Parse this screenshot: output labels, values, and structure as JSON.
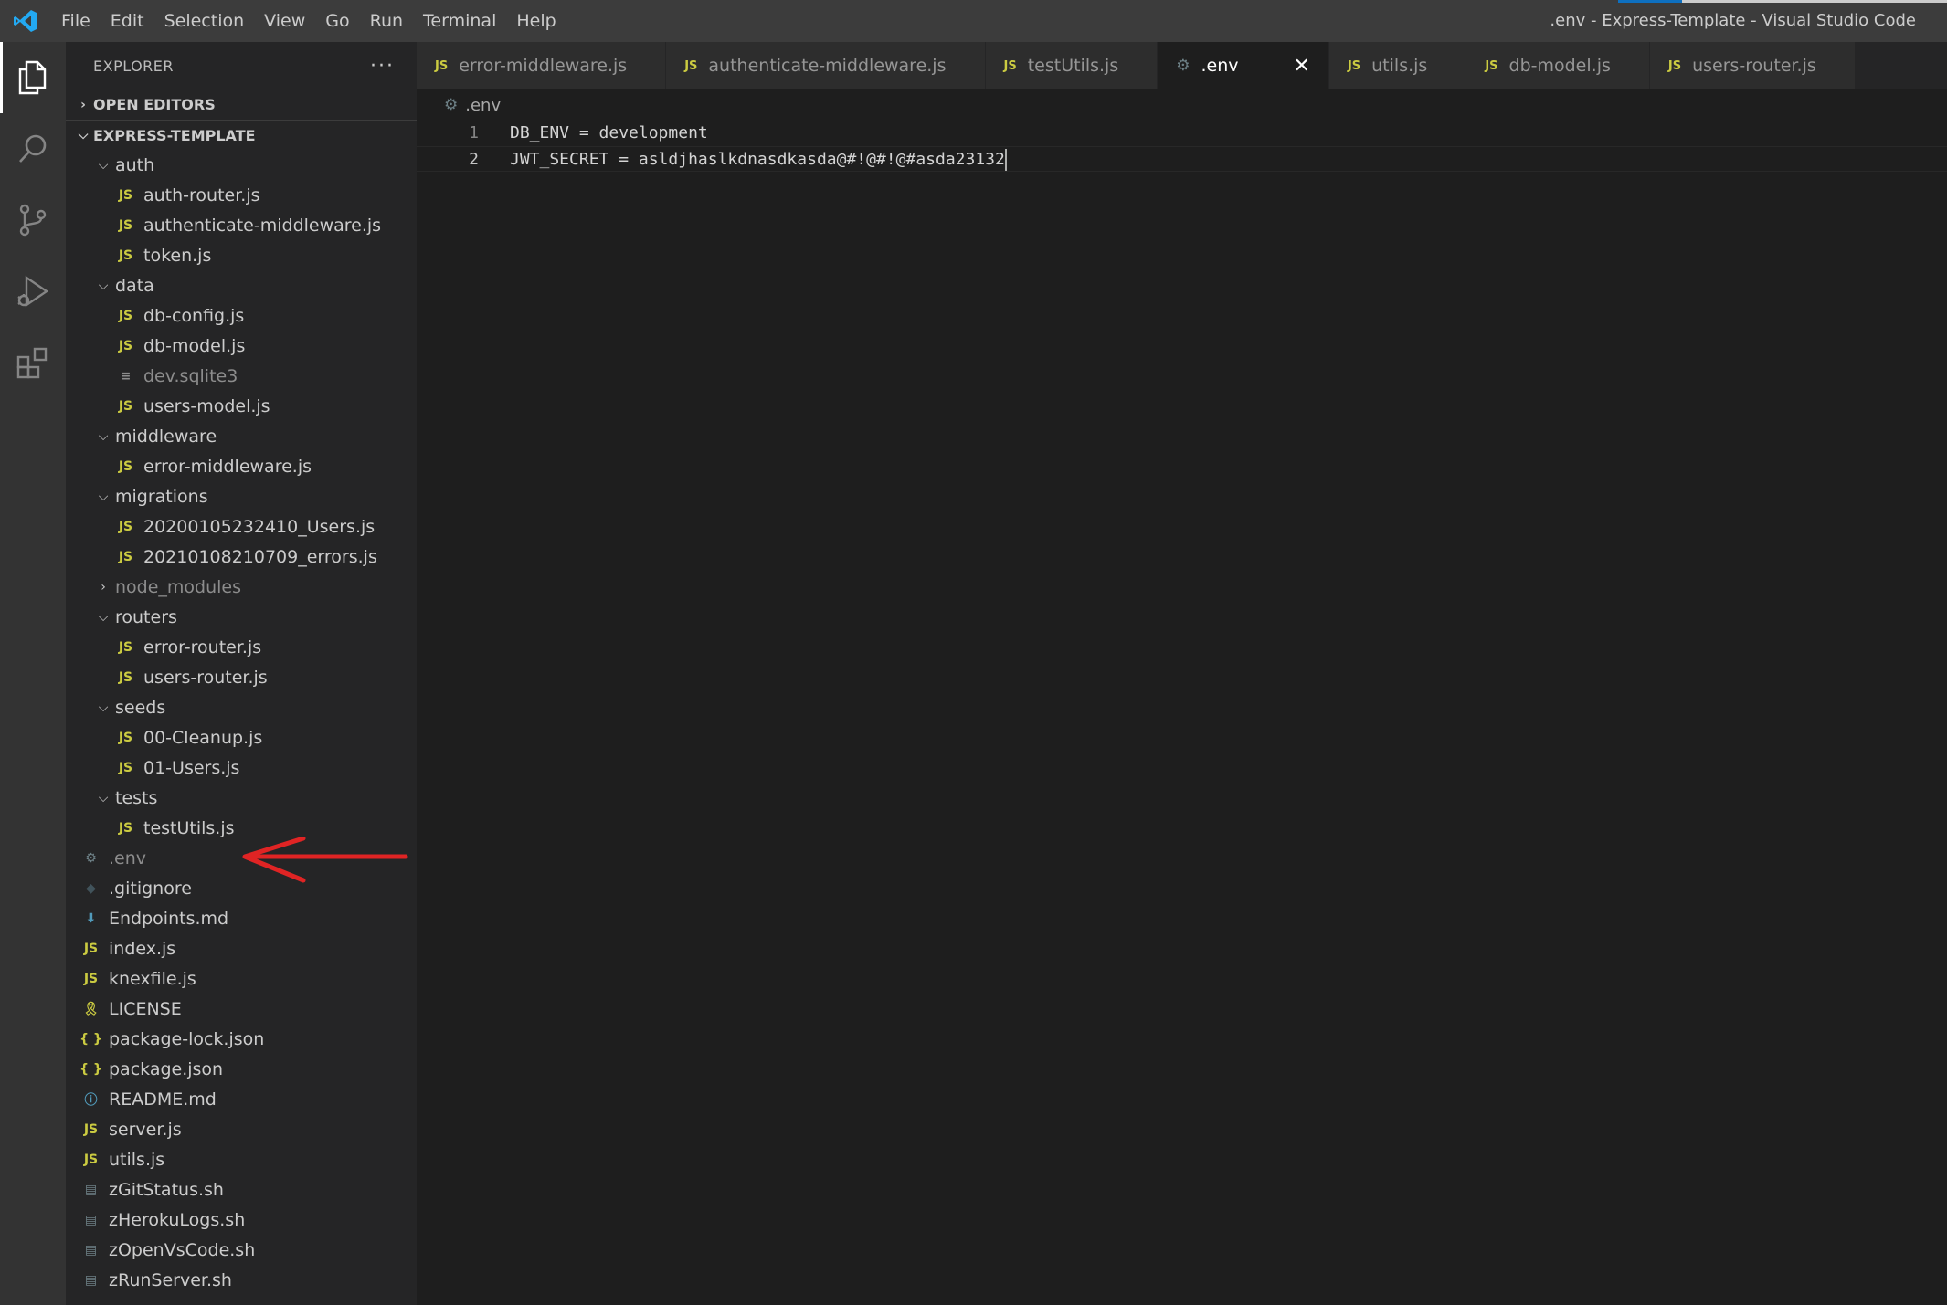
{
  "titlebar": {
    "menu": [
      "File",
      "Edit",
      "Selection",
      "View",
      "Go",
      "Run",
      "Terminal",
      "Help"
    ],
    "window_title": ".env - Express-Template - Visual Studio Code"
  },
  "activitybar": {
    "items": [
      "explorer-icon",
      "search-icon",
      "source-control-icon",
      "run-debug-icon",
      "extensions-icon"
    ]
  },
  "sidebar": {
    "title": "EXPLORER",
    "more": "···",
    "open_editors_label": "OPEN EDITORS",
    "project_label": "EXPRESS-TEMPLATE",
    "tree": [
      {
        "label": "auth",
        "kind": "folder",
        "depth": 1
      },
      {
        "label": "auth-router.js",
        "kind": "js",
        "depth": 2
      },
      {
        "label": "authenticate-middleware.js",
        "kind": "js",
        "depth": 2
      },
      {
        "label": "token.js",
        "kind": "js",
        "depth": 2
      },
      {
        "label": "data",
        "kind": "folder",
        "depth": 1
      },
      {
        "label": "db-config.js",
        "kind": "js",
        "depth": 2
      },
      {
        "label": "db-model.js",
        "kind": "js",
        "depth": 2
      },
      {
        "label": "dev.sqlite3",
        "kind": "txt",
        "depth": 2,
        "dim": true
      },
      {
        "label": "users-model.js",
        "kind": "js",
        "depth": 2
      },
      {
        "label": "middleware",
        "kind": "folder",
        "depth": 1
      },
      {
        "label": "error-middleware.js",
        "kind": "js",
        "depth": 2
      },
      {
        "label": "migrations",
        "kind": "folder",
        "depth": 1
      },
      {
        "label": "20200105232410_Users.js",
        "kind": "js",
        "depth": 2
      },
      {
        "label": "20210108210709_errors.js",
        "kind": "js",
        "depth": 2
      },
      {
        "label": "node_modules",
        "kind": "folder-collapsed",
        "depth": 1,
        "dim": true
      },
      {
        "label": "routers",
        "kind": "folder",
        "depth": 1
      },
      {
        "label": "error-router.js",
        "kind": "js",
        "depth": 2
      },
      {
        "label": "users-router.js",
        "kind": "js",
        "depth": 2
      },
      {
        "label": "seeds",
        "kind": "folder",
        "depth": 1
      },
      {
        "label": "00-Cleanup.js",
        "kind": "js",
        "depth": 2
      },
      {
        "label": "01-Users.js",
        "kind": "js",
        "depth": 2
      },
      {
        "label": "tests",
        "kind": "folder",
        "depth": 1
      },
      {
        "label": "testUtils.js",
        "kind": "js",
        "depth": 2
      },
      {
        "label": ".env",
        "kind": "gear",
        "depth": 1,
        "dim": true
      },
      {
        "label": ".gitignore",
        "kind": "git",
        "depth": 1
      },
      {
        "label": "Endpoints.md",
        "kind": "md",
        "depth": 1
      },
      {
        "label": "index.js",
        "kind": "js",
        "depth": 1
      },
      {
        "label": "knexfile.js",
        "kind": "js",
        "depth": 1
      },
      {
        "label": "LICENSE",
        "kind": "lic",
        "depth": 1
      },
      {
        "label": "package-lock.json",
        "kind": "json",
        "depth": 1
      },
      {
        "label": "package.json",
        "kind": "json",
        "depth": 1
      },
      {
        "label": "README.md",
        "kind": "info",
        "depth": 1
      },
      {
        "label": "server.js",
        "kind": "js",
        "depth": 1
      },
      {
        "label": "utils.js",
        "kind": "js",
        "depth": 1
      },
      {
        "label": "zGitStatus.sh",
        "kind": "sh",
        "depth": 1
      },
      {
        "label": "zHerokuLogs.sh",
        "kind": "sh",
        "depth": 1
      },
      {
        "label": "zOpenVsCode.sh",
        "kind": "sh",
        "depth": 1
      },
      {
        "label": "zRunServer.sh",
        "kind": "sh",
        "depth": 1
      }
    ]
  },
  "tabs": [
    {
      "label": "error-middleware.js",
      "kind": "js",
      "active": false
    },
    {
      "label": "authenticate-middleware.js",
      "kind": "js",
      "active": false
    },
    {
      "label": "testUtils.js",
      "kind": "js",
      "active": false
    },
    {
      "label": ".env",
      "kind": "gear",
      "active": true
    },
    {
      "label": "utils.js",
      "kind": "js",
      "active": false
    },
    {
      "label": "db-model.js",
      "kind": "js",
      "active": false
    },
    {
      "label": "users-router.js",
      "kind": "js",
      "active": false
    }
  ],
  "breadcrumb": ".env",
  "editor": {
    "lines": [
      {
        "number": "1",
        "text": "DB_ENV = development"
      },
      {
        "number": "2",
        "text": "JWT_SECRET = asldjhaslkdnasdkasda@#!@#!@#asda23132"
      }
    ],
    "current_line": 2
  },
  "icons": {
    "js": "JS",
    "gear": "⚙",
    "git": "◆",
    "md": "⬇",
    "lic": "🎗",
    "json": "{ }",
    "info": "ⓘ",
    "sh": "▤",
    "txt": "≡",
    "chevron_down": "⌵",
    "chevron_right": "›",
    "close": "✕"
  },
  "colors": {
    "js": "#cbcb41",
    "annotation_arrow": "#e02424",
    "accent": "#0e70c0"
  }
}
